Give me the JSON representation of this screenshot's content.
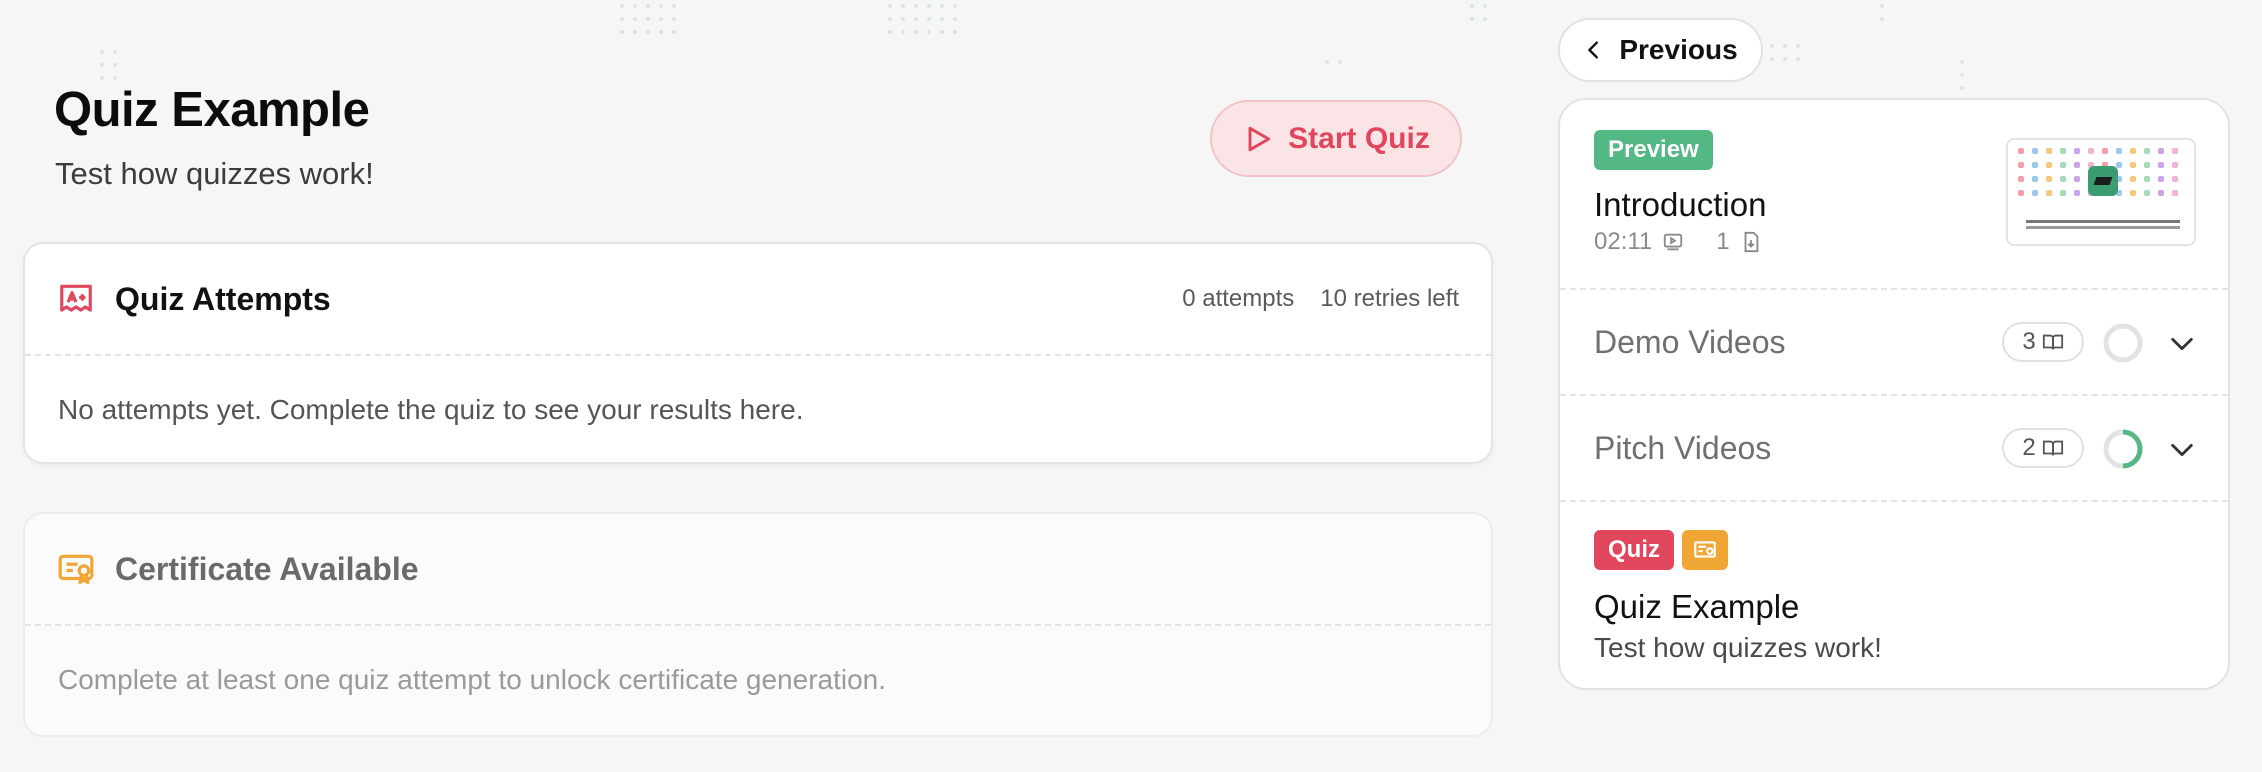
{
  "header": {
    "title": "Quiz Example",
    "subtitle": "Test how quizzes work!",
    "start_label": "Start Quiz"
  },
  "attempts_card": {
    "title": "Quiz Attempts",
    "attempts": "0 attempts",
    "retries": "10 retries left",
    "empty_text": "No attempts yet. Complete the quiz to see your results here."
  },
  "certificate_card": {
    "title": "Certificate Available",
    "text": "Complete at least one quiz attempt to unlock certificate generation."
  },
  "nav": {
    "previous_label": "Previous"
  },
  "sidebar": {
    "intro": {
      "badge": "Preview",
      "title": "Introduction",
      "duration": "02:11",
      "downloads": "1"
    },
    "sections": [
      {
        "title": "Demo Videos",
        "count": "3",
        "progress": 0
      },
      {
        "title": "Pitch Videos",
        "count": "2",
        "progress": 0.5
      }
    ],
    "quiz": {
      "badge": "Quiz",
      "title": "Quiz Example",
      "subtitle": "Test how quizzes work!"
    }
  },
  "colors": {
    "accent_red": "#e0475d",
    "preview_green": "#54b885",
    "certificate_orange": "#efa634"
  },
  "icons": {
    "start": "play-icon",
    "attempts": "award-icon",
    "certificate": "certificate-icon",
    "previous": "chevron-left-icon",
    "video": "video-icon",
    "download": "download-icon",
    "lessons": "book-icon",
    "expand": "chevron-down-icon"
  }
}
